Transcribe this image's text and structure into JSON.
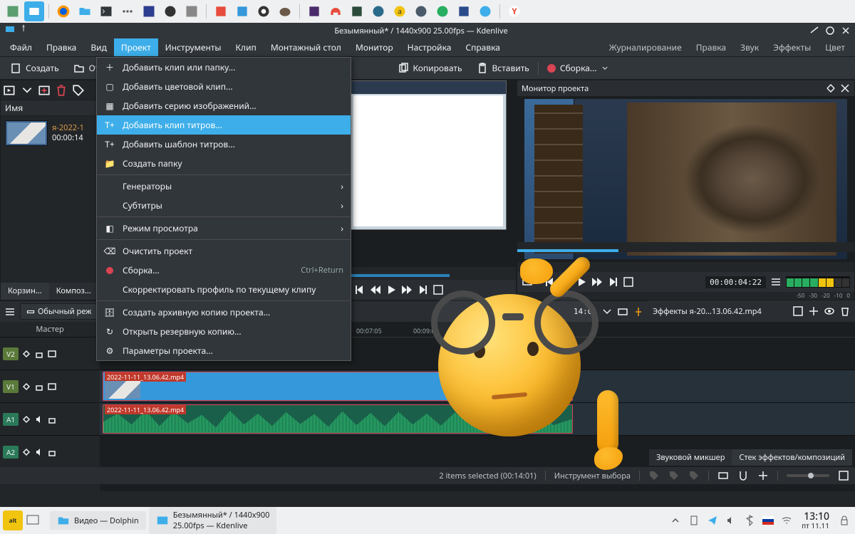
{
  "titlebar": {
    "text": "Безымянный* / 1440x900 25.00fps — Kdenlive"
  },
  "menubar": {
    "items": [
      "Файл",
      "Правка",
      "Вид",
      "Проект",
      "Инструменты",
      "Клип",
      "Монтажный стол",
      "Монитор",
      "Настройка",
      "Справка"
    ],
    "open_index": 3,
    "right": [
      "Журналирование",
      "Правка",
      "Звук",
      "Эффекты",
      "Цвет"
    ]
  },
  "toolbar": {
    "create": "Создать",
    "open_hidden": "От...",
    "copy": "Копировать",
    "paste": "Вставить",
    "render": "Сборка..."
  },
  "projectbin": {
    "header": "Имя",
    "clip": {
      "name": "я-2022-1",
      "duration": "00:00:14"
    },
    "tabs": [
      "Корзин...",
      "Композ..."
    ]
  },
  "dropdown": {
    "items": [
      {
        "icon": "plus",
        "label": "Добавить клип или папку..."
      },
      {
        "icon": "swatch",
        "label": "Добавить цветовой клип..."
      },
      {
        "icon": "grid",
        "label": "Добавить серию изображений..."
      },
      {
        "icon": "title",
        "label": "Добавить клип титров...",
        "highlight": true
      },
      {
        "icon": "title",
        "label": "Добавить шаблон титров..."
      },
      {
        "icon": "folder",
        "label": "Создать папку"
      },
      {
        "sep": true
      },
      {
        "icon": "",
        "label": "Генераторы",
        "submenu": true
      },
      {
        "icon": "",
        "label": "Субтитры",
        "submenu": true
      },
      {
        "sep": true
      },
      {
        "icon": "view",
        "label": "Режим просмотра",
        "submenu": true
      },
      {
        "sep": true
      },
      {
        "icon": "clear",
        "label": "Очистить проект"
      },
      {
        "icon": "dot",
        "label": "Сборка...",
        "shortcut": "Ctrl+Return"
      },
      {
        "icon": "",
        "label": "Скорректировать профиль по текущему клипу"
      },
      {
        "sep": true
      },
      {
        "icon": "archive",
        "label": "Создать архивную копию проекта..."
      },
      {
        "icon": "restore",
        "label": "Открыть резервную копию..."
      },
      {
        "icon": "settings",
        "label": "Параметры проекта..."
      }
    ]
  },
  "projmon": {
    "title": "Монитор проекта",
    "timecode": "00:00:04:22"
  },
  "meter": {
    "labels": [
      "-50",
      "-30",
      "-20",
      "-10",
      "0"
    ]
  },
  "tl_tools": {
    "mode": "Обычный реж",
    "tc": "14:01"
  },
  "fx": {
    "title": "Эффекты я-20...13.06.42.mp4"
  },
  "ruler": {
    "ticks": [
      "00:07:05",
      "00:09:00"
    ]
  },
  "tracks": {
    "master": "Мастер",
    "list": [
      {
        "id": "V2",
        "type": "v"
      },
      {
        "id": "V1",
        "type": "v"
      },
      {
        "id": "A1",
        "type": "a"
      },
      {
        "id": "A2",
        "type": "a"
      }
    ],
    "clip_label": "2022-11-11_13.06.42.mp4"
  },
  "bottom_tabs": [
    "Звуковой микшер",
    "Стек эффектов/композиций"
  ],
  "statusbar": {
    "selection": "2 items selected (00:14:01)",
    "tool": "Инструмент выбора"
  },
  "os_bottom": {
    "task1": "Видео — Dolphin",
    "task2a": "Безымянный* / 1440x900",
    "task2b": "25.00fps — Kdenlive",
    "time": "13:10",
    "date": "пт 11.11",
    "alt": "alt"
  }
}
